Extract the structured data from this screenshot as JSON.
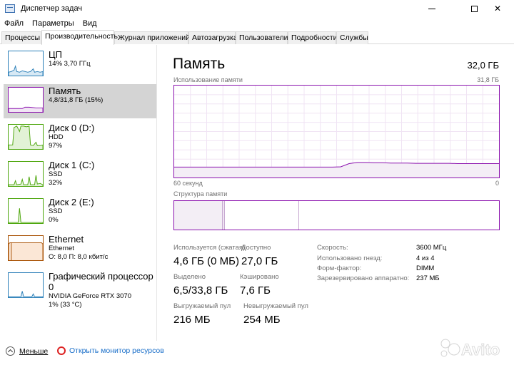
{
  "window": {
    "title": "Диспетчер задач"
  },
  "menu": [
    "Файл",
    "Параметры",
    "Вид"
  ],
  "tabs": [
    {
      "label": "Процессы"
    },
    {
      "label": "Производительность"
    },
    {
      "label": "Журнал приложений"
    },
    {
      "label": "Автозагрузка"
    },
    {
      "label": "Пользователи"
    },
    {
      "label": "Подробности"
    },
    {
      "label": "Службы"
    }
  ],
  "sidebar": {
    "items": [
      {
        "name": "ЦП",
        "line1": "14% 3,70 ГГц",
        "line2": "",
        "color": "#2b7fb8"
      },
      {
        "name": "Память",
        "line1": "4,8/31,8 ГБ (15%)",
        "line2": "",
        "color": "#8b12ae"
      },
      {
        "name": "Диск 0 (D:)",
        "line1": "HDD",
        "line2": "97%",
        "color": "#4da60c"
      },
      {
        "name": "Диск 1 (C:)",
        "line1": "SSD",
        "line2": "32%",
        "color": "#4da60c"
      },
      {
        "name": "Диск 2 (E:)",
        "line1": "SSD",
        "line2": "0%",
        "color": "#4da60c"
      },
      {
        "name": "Ethernet",
        "line1": "Ethernet",
        "line2": "О: 8,0 П: 8,0 кбит/с",
        "color": "#a74f01"
      },
      {
        "name": "Графический процессор 0",
        "line1": "NVIDIA GeForce RTX 3070",
        "line2": "1% (33 °C)",
        "color": "#2b7fb8"
      }
    ]
  },
  "main": {
    "title": "Память",
    "total": "32,0 ГБ",
    "chart_label": "Использование памяти",
    "chart_max": "31,8 ГБ",
    "axis_left": "60 секунд",
    "axis_right": "0",
    "structure_label": "Структура памяти",
    "accent": "#8b12ae",
    "usage_history_gb": [
      3.6,
      3.6,
      3.6,
      3.6,
      3.6,
      3.6,
      3.6,
      3.6,
      3.6,
      3.6,
      3.6,
      3.6,
      3.6,
      3.6,
      3.6,
      3.6,
      3.6,
      3.6,
      3.6,
      3.6,
      3.7,
      4.8,
      5.2,
      5.2,
      5.1,
      5.1,
      5.0,
      5.0,
      5.0,
      4.9,
      4.9,
      4.9,
      4.9,
      4.9,
      4.8,
      4.8,
      4.8,
      4.8,
      4.8,
      4.8
    ],
    "stats": [
      {
        "label": "Используется (сжатая)",
        "value": "4,6 ГБ (0 МБ)"
      },
      {
        "label": "Доступно",
        "value": "27,0 ГБ"
      },
      {
        "label": "Выделено",
        "value": "6,5/33,8 ГБ"
      },
      {
        "label": "Кэшировано",
        "value": "7,6 ГБ"
      },
      {
        "label": "Выгружаемый пул",
        "value": "216 МБ"
      },
      {
        "label": "Невыгружаемый пул",
        "value": "254 МБ"
      }
    ],
    "specs": [
      {
        "label": "Скорость:",
        "value": "3600 МГц"
      },
      {
        "label": "Использовано гнезд:",
        "value": "4 из 4"
      },
      {
        "label": "Форм-фактор:",
        "value": "DIMM"
      },
      {
        "label": "Зарезервировано аппаратно:",
        "value": "237 МБ"
      }
    ]
  },
  "footer": {
    "fewer": "Меньше",
    "monitor": "Открыть монитор ресурсов"
  }
}
